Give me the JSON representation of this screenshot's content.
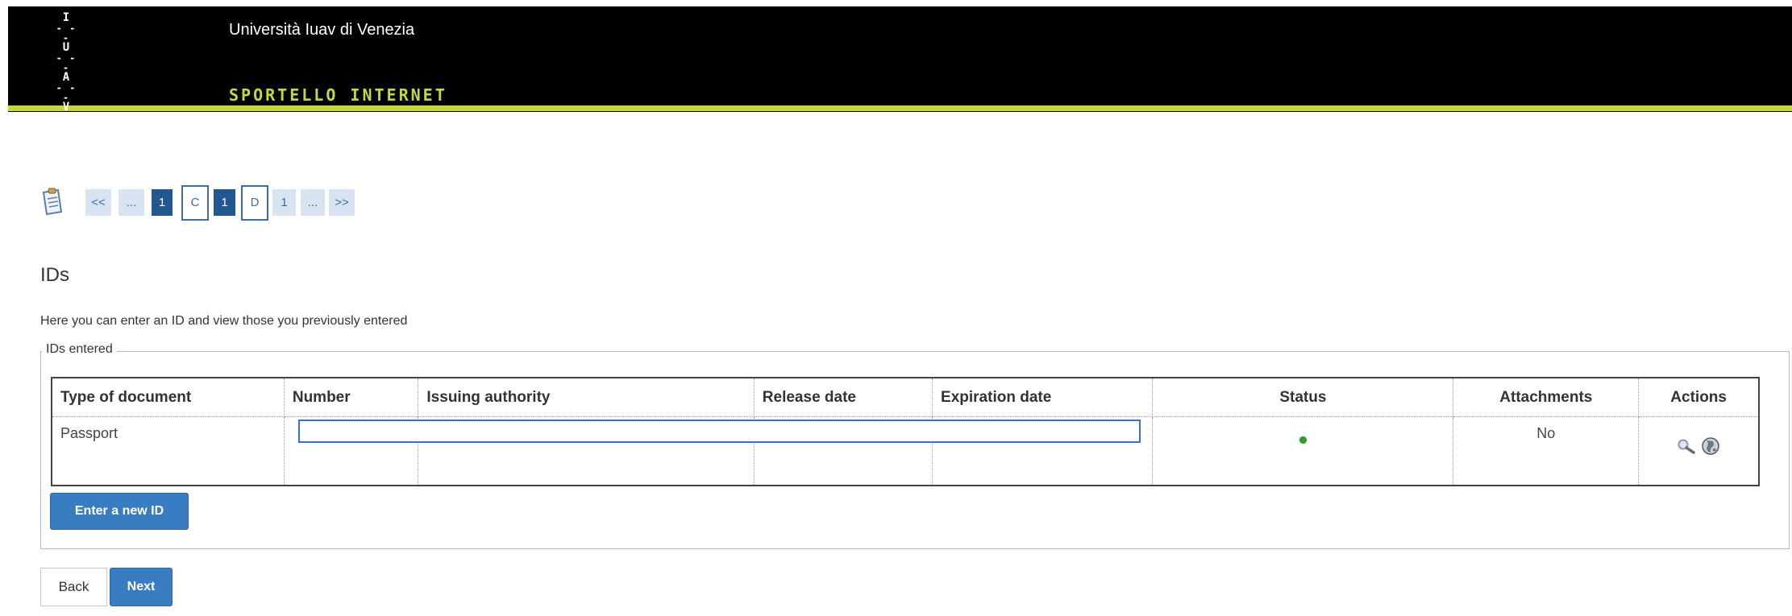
{
  "header": {
    "logo_letters": [
      "I",
      "U",
      "A",
      "V"
    ],
    "university_name": "Università Iuav di Venezia",
    "service_name": "SPORTELLO INTERNET",
    "background_color": "#000000",
    "accent_color": "#c8d63e"
  },
  "pager": {
    "icon": "clipboard-icon",
    "items": [
      "<<",
      "...",
      "1",
      "C",
      "1",
      "D",
      "1",
      "...",
      ">>"
    ],
    "current": "1"
  },
  "page": {
    "title": "IDs",
    "intro": "Here you can enter an ID and view those you previously entered",
    "legend": "IDs entered"
  },
  "table": {
    "headers": [
      "Type of document",
      "Number",
      "Issuing authority",
      "Release date",
      "Expiration date",
      "Status",
      "Attachments",
      "Actions"
    ],
    "rows": [
      {
        "type": "Passport",
        "number": "",
        "issuing_authority": "",
        "release_date": "",
        "expiration_date": "",
        "status_color": "#2f9a2f",
        "attachments": "No",
        "action_icons": [
          "magnifier-icon",
          "globe-icon"
        ]
      }
    ]
  },
  "buttons": {
    "enter_new_id": "Enter a new ID",
    "back": "Back",
    "next": "Next",
    "primary_color": "#3a7cc2"
  }
}
